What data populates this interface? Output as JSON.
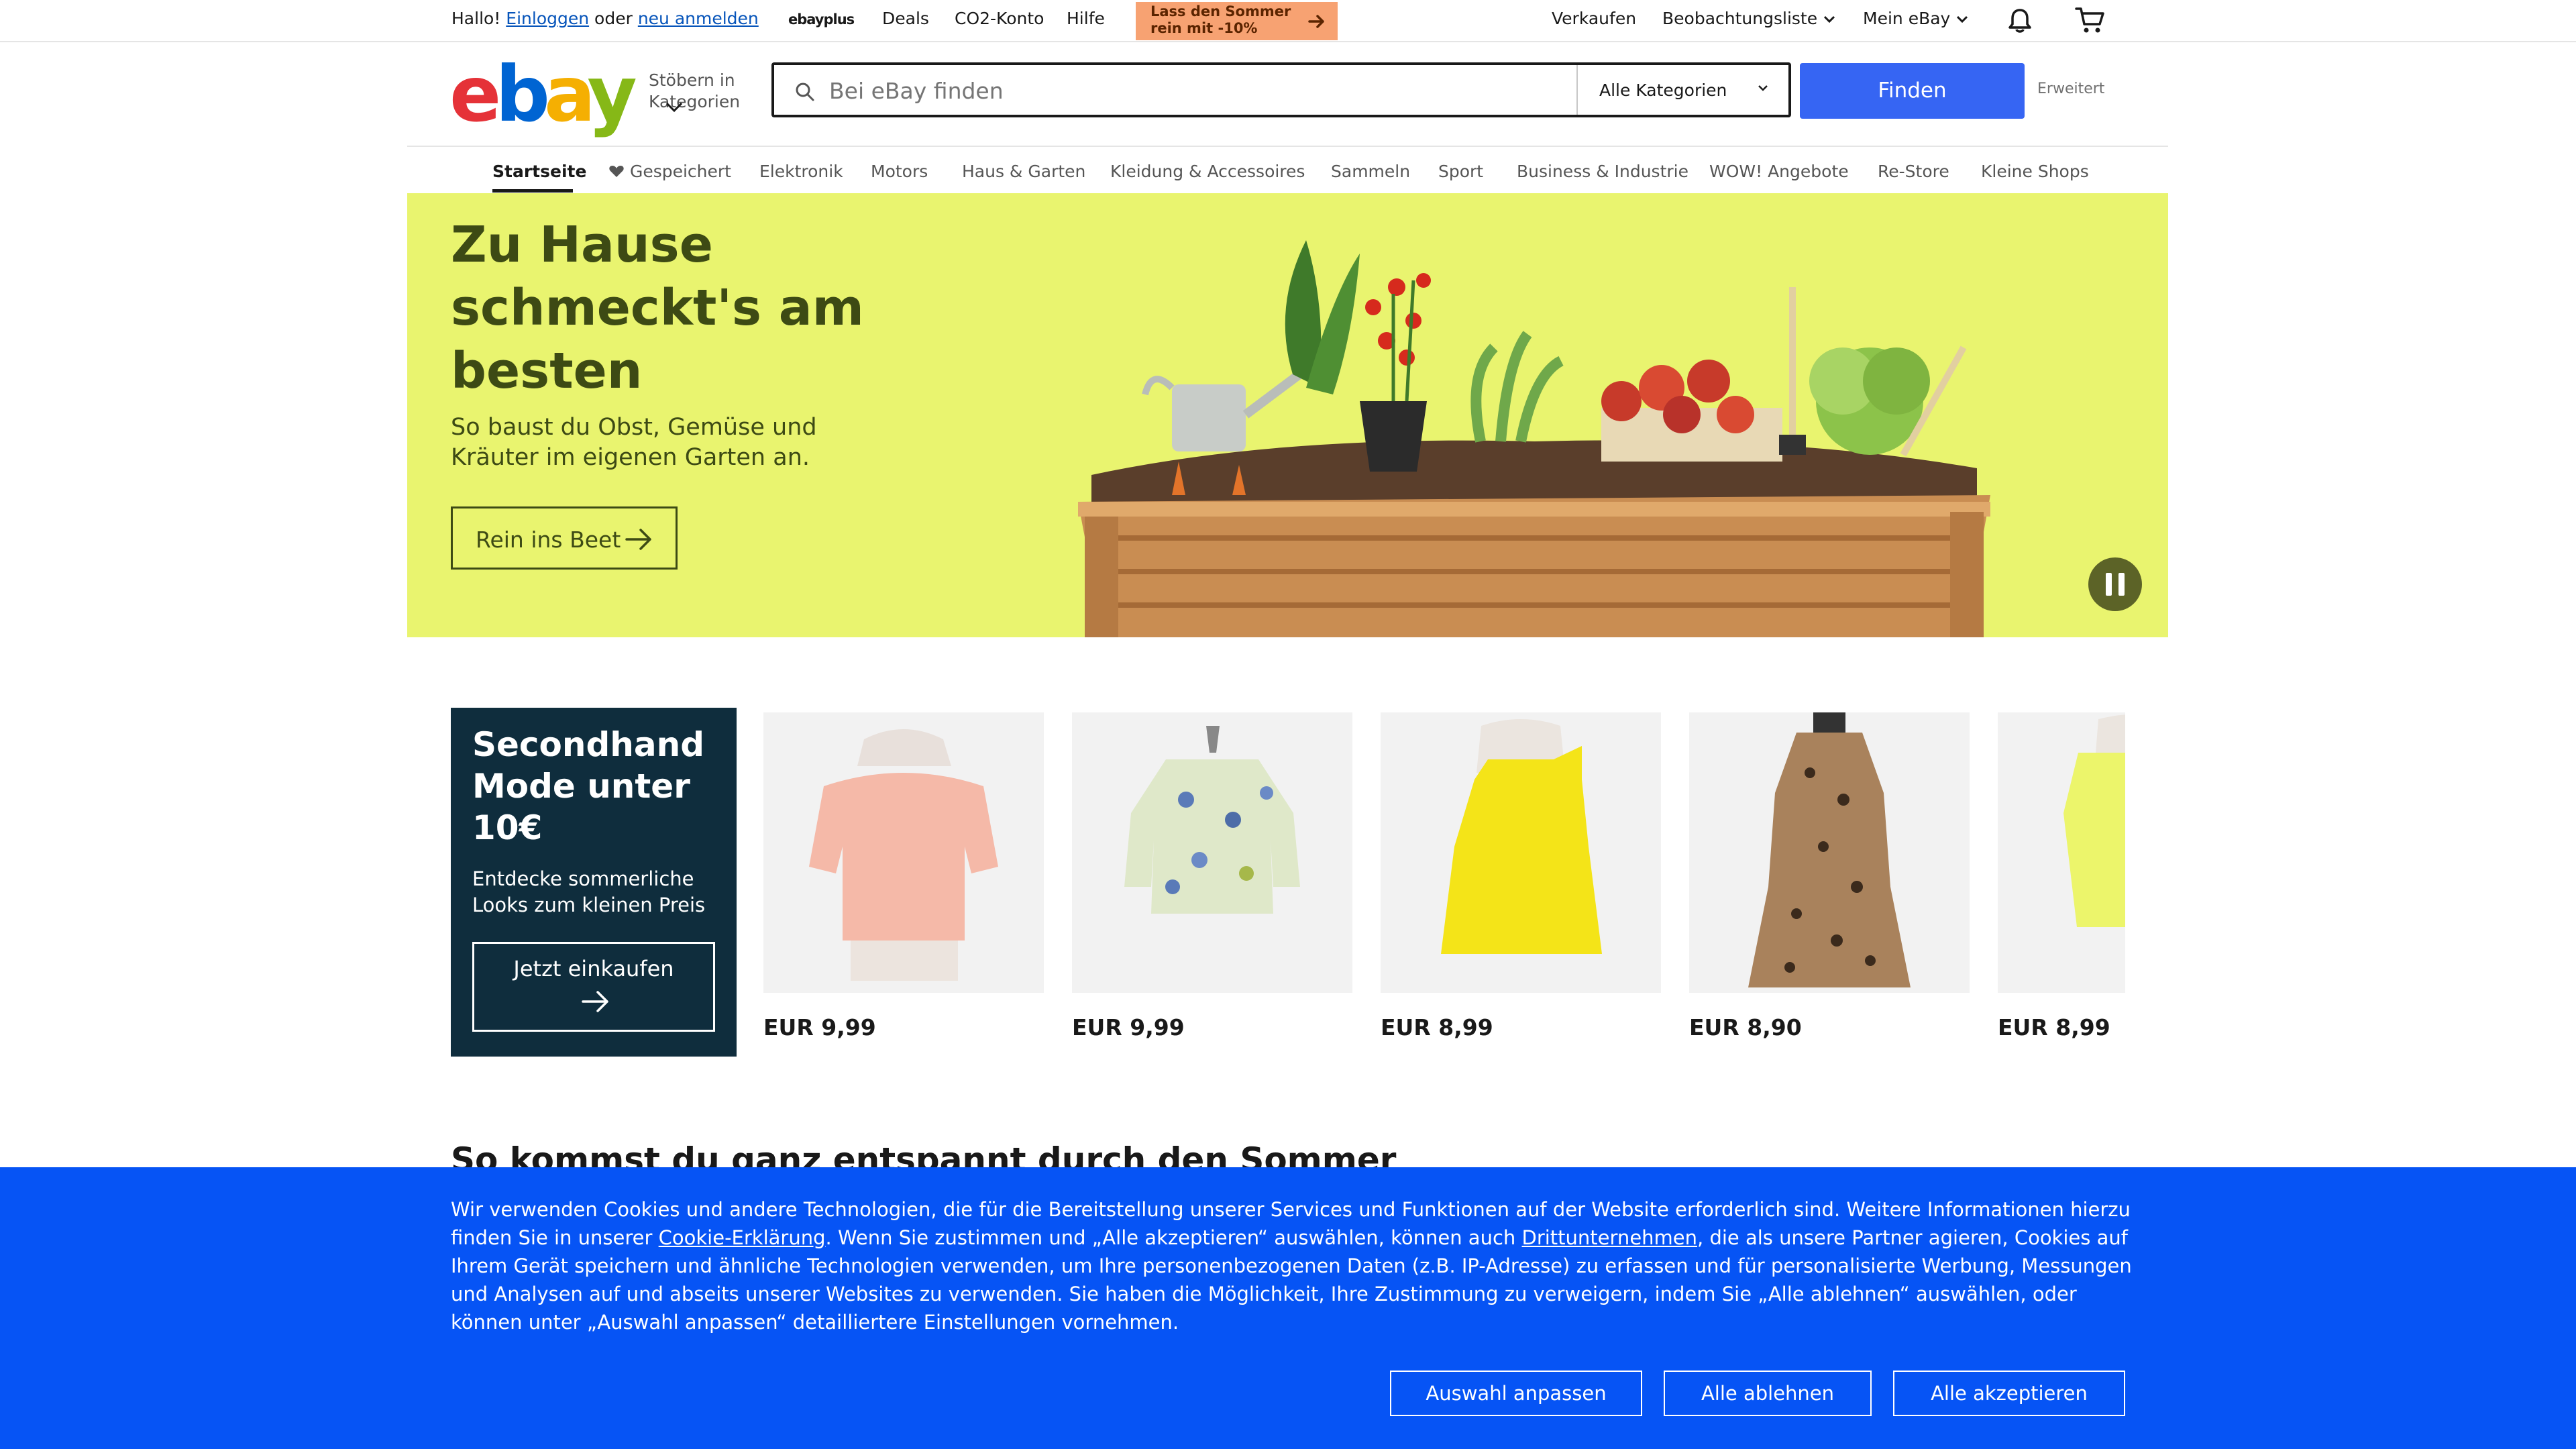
{
  "topbar": {
    "greeting": "Hallo!",
    "login_link": "Einloggen",
    "or_text": "oder",
    "register_link": "neu anmelden",
    "ebayplus_label": "ebayplus",
    "deals": "Deals",
    "co2": "CO2-Konto",
    "help": "Hilfe",
    "promo_line1": "Lass den Sommer",
    "promo_line2": "rein mit -10%",
    "sell": "Verkaufen",
    "watchlist": "Beobachtungsliste",
    "my_ebay": "Mein eBay",
    "icons": [
      "bell-icon",
      "cart-icon"
    ]
  },
  "header": {
    "logo": {
      "e": "e",
      "b": "b",
      "a": "a",
      "y": "y"
    },
    "browse_label": "Stöbern in Kategorien",
    "search_placeholder": "Bei eBay finden",
    "category_select": "Alle Kategorien",
    "find_button": "Finden",
    "advanced_link": "Erweitert"
  },
  "nav": {
    "items": [
      "Startseite",
      "Gespeichert",
      "Elektronik",
      "Motors",
      "Haus & Garten",
      "Kleidung & Accessoires",
      "Sammeln",
      "Sport",
      "Business & Industrie",
      "WOW! Angebote",
      "Re-Store",
      "Kleine Shops"
    ],
    "active": "Startseite"
  },
  "hero": {
    "title": "Zu Hause schmeckt's am besten",
    "subtitle": "So baust du Obst, Gemüse und Kräuter im eigenen Garten an.",
    "cta": "Rein ins Beet",
    "background_color": "#e9f46f"
  },
  "secondhand": {
    "title": "Secondhand Mode unter 10€",
    "subtitle": "Entdecke sommerliche Looks zum kleinen Preis",
    "cta": "Jetzt einkaufen",
    "products": [
      {
        "price": "EUR 9,99"
      },
      {
        "price": "EUR 9,99"
      },
      {
        "price": "EUR 8,99"
      },
      {
        "price": "EUR 8,90"
      },
      {
        "price": "EUR 8,99"
      }
    ]
  },
  "section": {
    "title": "So kommst du ganz entspannt durch den Sommer"
  },
  "cookie": {
    "text_1": "Wir verwenden Cookies und andere Technologien, die für die Bereitstellung unserer Services und Funktionen auf der Website erforderlich sind. Weitere Informationen hierzu finden Sie in unserer ",
    "link_1": "Cookie-Erklärung",
    "text_2": ". Wenn Sie zustimmen und „Alle akzeptieren“ auswählen, können auch ",
    "link_2": "Drittunternehmen",
    "text_3": ", die als unsere Partner agieren, Cookies auf Ihrem Gerät speichern und ähnliche Technologien verwenden, um Ihre personenbezogenen Daten (z.B. IP-Adresse) zu erfassen und für personalisierte Werbung, Messungen und Analysen auf und abseits unserer Websites zu verwenden. Sie haben die Möglichkeit, Ihre Zustimmung zu verweigern, indem Sie „Alle ablehnen“ auswählen, oder können unter „Auswahl anpassen“ detailliertere Einstellungen vornehmen.",
    "btn_customize": "Auswahl anpassen",
    "btn_reject": "Alle ablehnen",
    "btn_accept": "Alle akzeptieren",
    "background_color": "#0654f5"
  }
}
